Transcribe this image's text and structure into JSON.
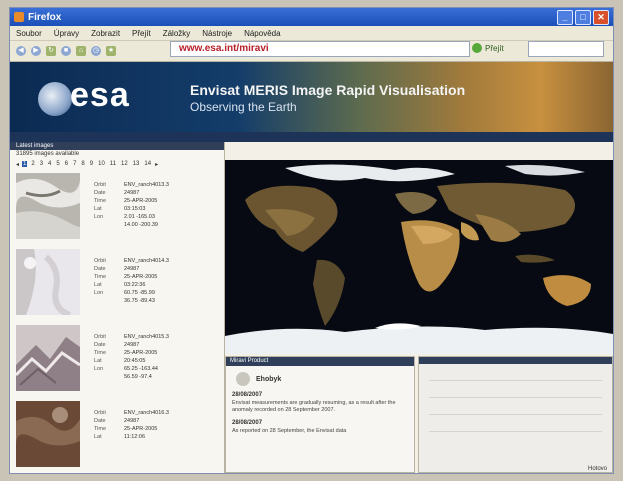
{
  "window": {
    "title": "Firefox"
  },
  "menu": [
    "Soubor",
    "Úpravy",
    "Zobrazit",
    "Přejít",
    "Záložky",
    "Nástroje",
    "Nápověda"
  ],
  "address": {
    "url": "www.esa.int/miravi"
  },
  "go_label": "Přejít",
  "banner": {
    "logo": "esa",
    "title": "Envisat MERIS Image Rapid Visualisation",
    "subtitle": "Observing the Earth"
  },
  "leftpanel": {
    "heading": "Latest images",
    "subheading": "31895 images available",
    "pages": [
      "1",
      "2",
      "3",
      "4",
      "5",
      "6",
      "7",
      "8",
      "9",
      "10",
      "11",
      "12",
      "13",
      "14"
    ],
    "current_page": "1",
    "field_labels": [
      "Orbit",
      "Date",
      "Time",
      "Lat",
      "Lon"
    ],
    "items": [
      {
        "name": "ENV_ranch4013.3",
        "fields": [
          "24987",
          "25-APR-2005",
          "03:15:03",
          "2.01 -165.03",
          "14.00 -200.39"
        ]
      },
      {
        "name": "ENV_ranch4014.3",
        "fields": [
          "24987",
          "25-APR-2005",
          "03:22:36",
          "60.75 -85.99",
          "36.75 -89.43"
        ]
      },
      {
        "name": "ENV_ranch4015.3",
        "fields": [
          "24987",
          "25-APR-2005",
          "20:45:05",
          "65.25 -163.44",
          "56.59 -97.4"
        ]
      },
      {
        "name": "ENV_ranch4016.3",
        "fields": [
          "24987",
          "25-APR-2005",
          "11:12:06"
        ]
      }
    ]
  },
  "news": {
    "heading": "Miravi Product",
    "profile": "Ehobyk",
    "entries": [
      {
        "date": "28/08/2007",
        "text": "Envisat measurements are gradually resuming, as a result after the anomaly recorded on 28 September 2007."
      },
      {
        "date": "28/08/2007",
        "text": "As reported on 28 September, the Envisat data"
      }
    ]
  },
  "statusbar": {
    "text": "Hotovo"
  }
}
